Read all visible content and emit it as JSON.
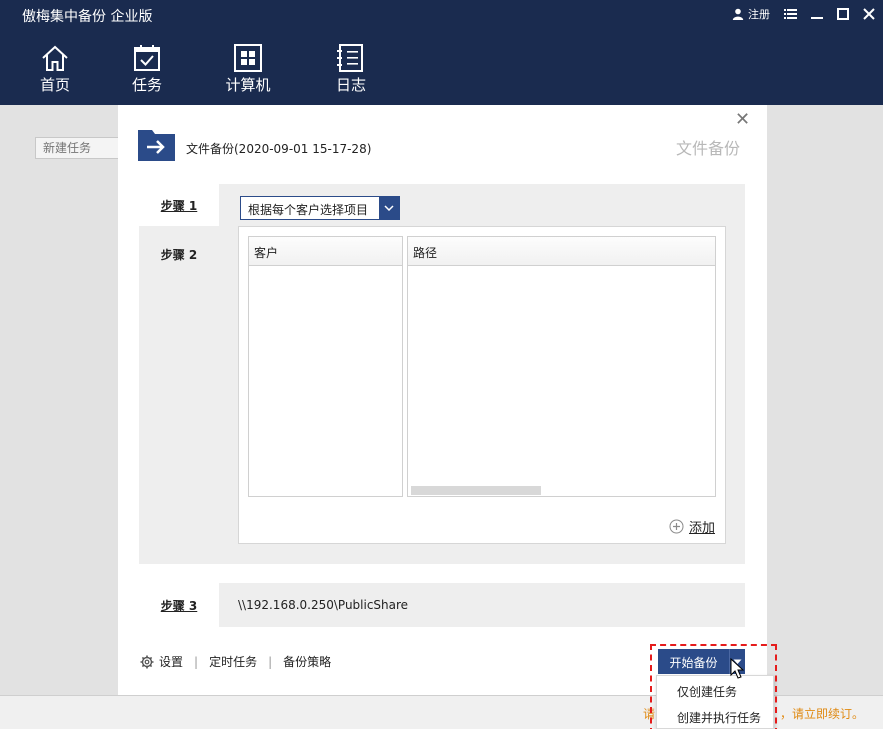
{
  "app": {
    "title": "傲梅集中备份 企业版",
    "register_label": "注册"
  },
  "nav": [
    {
      "label": "首页",
      "icon": "home-icon"
    },
    {
      "label": "任务",
      "icon": "calendar-check-icon"
    },
    {
      "label": "计算机",
      "icon": "windows-icon"
    },
    {
      "label": "日志",
      "icon": "log-list-icon"
    }
  ],
  "background": {
    "new_task_placeholder": "新建任务",
    "status_link_left": "请",
    "status_link_right": "，请立即续订。"
  },
  "dialog": {
    "task_name": "文件备份(2020-09-01 15-17-28)",
    "task_type": "文件备份",
    "steps": {
      "step1": "步骤 1",
      "step2": "步骤 2",
      "step3": "步骤 3"
    },
    "client_select": {
      "selected": "根据每个客户选择项目"
    },
    "table": {
      "columns": [
        "客户",
        "路径"
      ],
      "rows": []
    },
    "add_label": "添加",
    "destination_path": "\\\\192.168.0.250\\PublicShare",
    "footer": {
      "settings": "设置",
      "schedule": "定时任务",
      "backup_policy": "备份策略"
    },
    "start_button": "开始备份",
    "dropdown": {
      "items": [
        "仅创建任务",
        "创建并执行任务"
      ]
    }
  },
  "colors": {
    "topbar": "#1a2b4f",
    "accent": "#2b4b89",
    "highlight": "#e51c1c",
    "status_link": "#e08a12"
  }
}
